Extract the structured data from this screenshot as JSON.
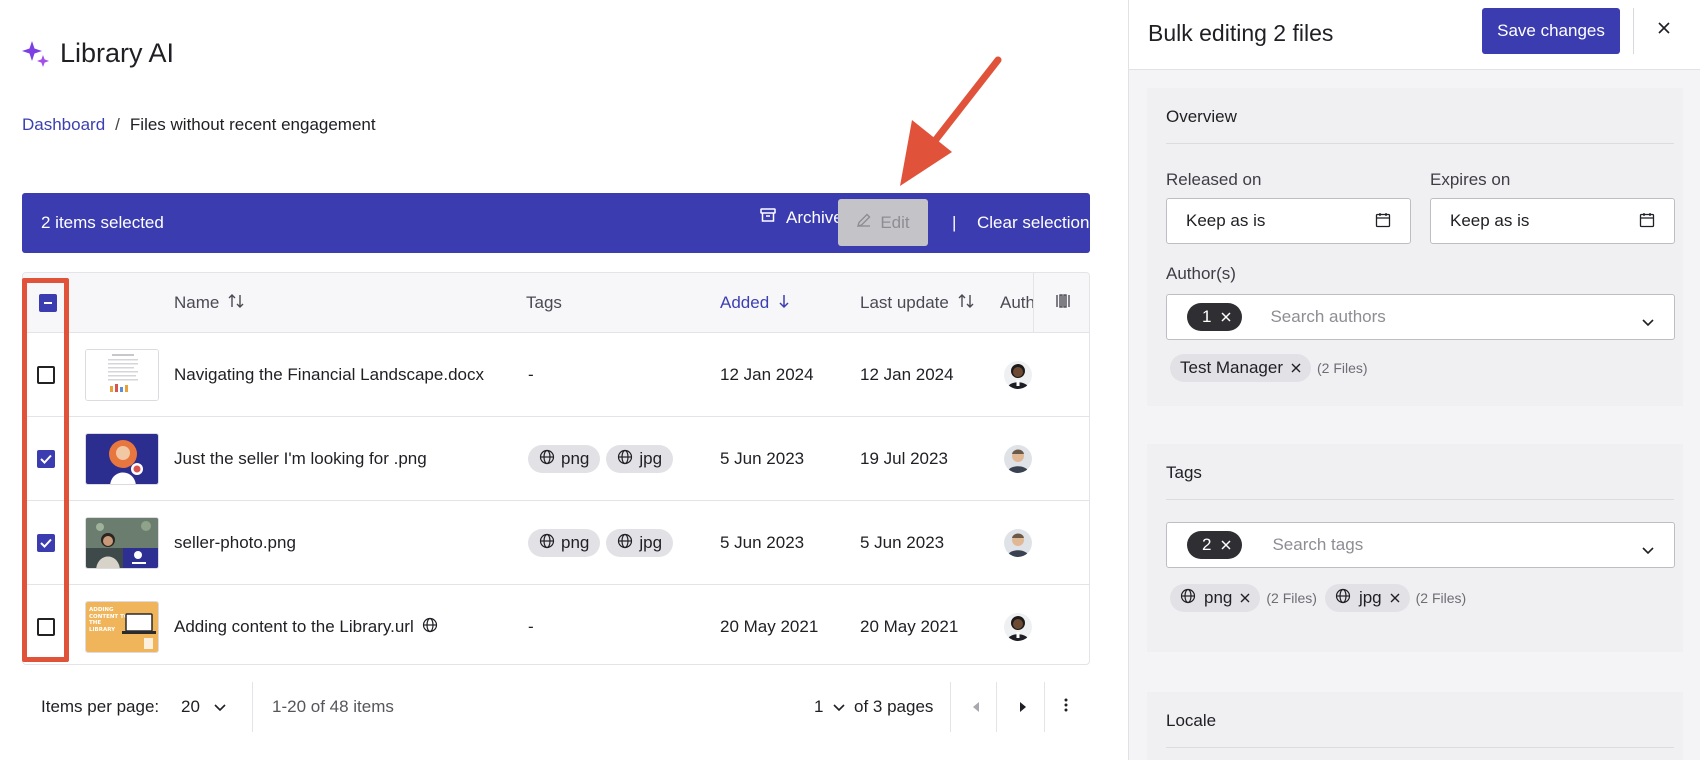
{
  "app": {
    "title": "Library AI"
  },
  "breadcrumb": {
    "root": "Dashboard",
    "separator": "/",
    "current": "Files without recent engagement"
  },
  "selection_bar": {
    "count_text": "2 items selected",
    "archive_label": "Archive",
    "edit_label": "Edit",
    "separator": "|",
    "clear_label": "Clear selection"
  },
  "table": {
    "headers": {
      "name": "Name",
      "tags": "Tags",
      "added": "Added",
      "last_update": "Last update",
      "author": "Auth"
    },
    "rows": [
      {
        "name": "Navigating the Financial Landscape.docx",
        "tags": "-",
        "tag_list": [],
        "added": "12 Jan 2024",
        "last_update": "12 Jan 2024",
        "checked": false,
        "thumb": "doc"
      },
      {
        "name": "Just the seller I'm looking for .png",
        "tags": "",
        "tag_list": [
          "png",
          "jpg"
        ],
        "added": "5 Jun 2023",
        "last_update": "19 Jul 2023",
        "checked": true,
        "thumb": "seller"
      },
      {
        "name": "seller-photo.png",
        "tags": "",
        "tag_list": [
          "png",
          "jpg"
        ],
        "added": "5 Jun 2023",
        "last_update": "5 Jun 2023",
        "checked": true,
        "thumb": "photo"
      },
      {
        "name": "Adding content to the Library.url",
        "tags": "-",
        "tag_list": [],
        "added": "20 May 2021",
        "last_update": "20 May 2021",
        "checked": false,
        "thumb": "url",
        "thumb_text": "ADDING CONTENT TO THE LIBRARY"
      }
    ]
  },
  "pagination": {
    "items_per_page_label": "Items per page:",
    "items_per_page": "20",
    "range_text": "1-20 of 48 items",
    "page": "1",
    "of_pages": "of 3 pages"
  },
  "panel": {
    "title": "Bulk editing 2 files",
    "save_label": "Save changes",
    "overview": {
      "title": "Overview",
      "released_label": "Released on",
      "released_value": "Keep as is",
      "expires_label": "Expires on",
      "expires_value": "Keep as is",
      "authors_label": "Author(s)",
      "authors_count": "1",
      "authors_placeholder": "Search authors",
      "author_chip": "Test Manager",
      "author_chip_note": "(2 Files)"
    },
    "tags": {
      "title": "Tags",
      "count": "2",
      "placeholder": "Search tags",
      "chips": [
        {
          "label": "png",
          "note": "(2 Files)"
        },
        {
          "label": "jpg",
          "note": "(2 Files)"
        }
      ]
    },
    "locale": {
      "title": "Locale"
    }
  },
  "colors": {
    "accent": "#3b3caf",
    "annotation": "#e0533a",
    "link": "#3b3fb0"
  }
}
